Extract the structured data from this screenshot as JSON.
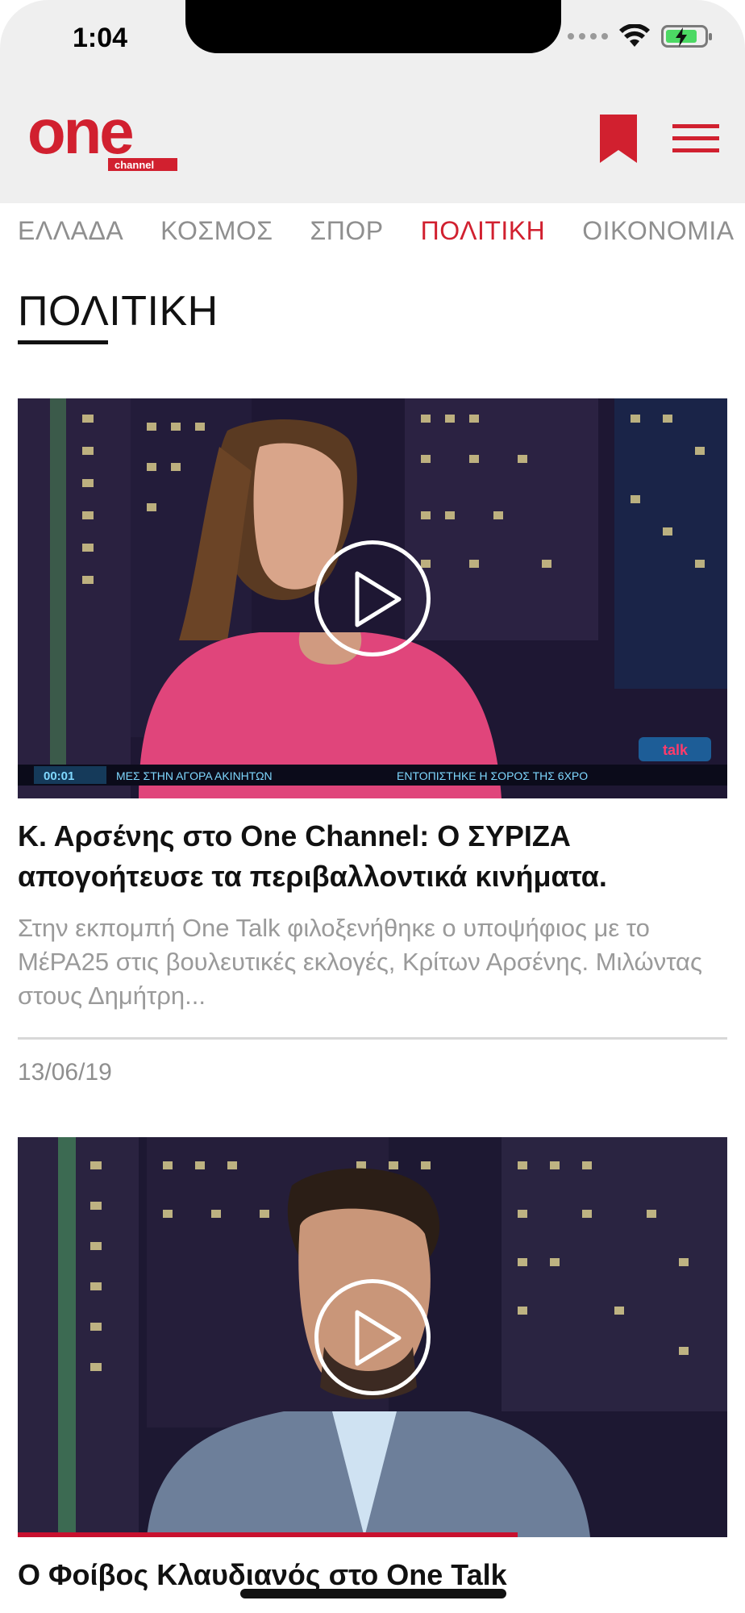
{
  "status_bar": {
    "time": "1:04"
  },
  "header": {
    "logo_text": "one",
    "logo_subtext": "channel",
    "brand_color": "#d1202f"
  },
  "categories": [
    {
      "label": "ΕΛΛΑΔΑ",
      "active": false
    },
    {
      "label": "ΚΟΣΜΟΣ",
      "active": false
    },
    {
      "label": "ΣΠΟΡ",
      "active": false
    },
    {
      "label": "ΠΟΛΙΤΙΚΗ",
      "active": true
    },
    {
      "label": "ΟΙΚΟΝΟΜΙΑ",
      "active": false
    }
  ],
  "section": {
    "title": "ΠΟΛΙΤΙΚΗ"
  },
  "articles": [
    {
      "title": "Κ. Αρσένης στο One Channel: Ο ΣΥΡΙΖΑ απογοήτευσε τα περιβαλλοντικά κινήματα.",
      "excerpt": "Στην εκπομπή One Talk φιλοξενήθηκε ο υποψήφιος με το ΜέΡΑ25 στις βουλευτικές εκλογές, Κρίτων Αρσένης. Μιλώντας στους Δημήτρη...",
      "date": "13/06/19",
      "ticker_time": "00:01",
      "ticker_text_1": "ΜΕΣ ΣΤΗΝ ΑΓΟΡΑ ΑΚΙΝΗΤΩΝ",
      "ticker_text_2": "ΕΝΤΟΠΙΣΤΗΚΕ Η ΣΟΡΟΣ ΤΗΣ 6ΧΡΟ",
      "show_logo_text": "talk"
    },
    {
      "title": "Ο Φοίβος Κλαυδιανός στο One Talk"
    }
  ],
  "icons": {
    "bookmark": "bookmark-icon",
    "menu": "hamburger-menu-icon",
    "play": "play-icon",
    "wifi": "wifi-icon",
    "battery": "battery-icon"
  }
}
